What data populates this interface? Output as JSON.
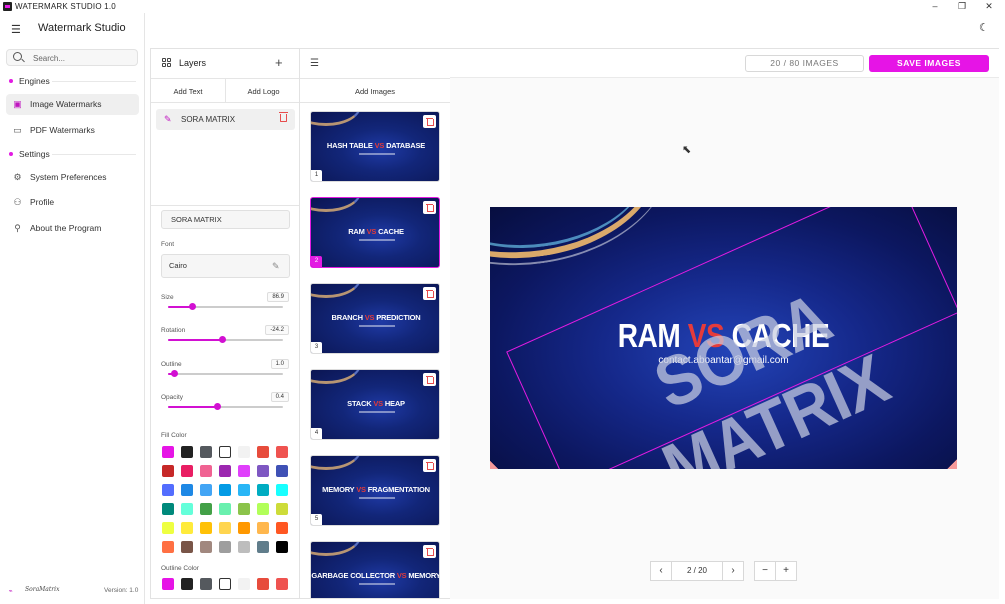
{
  "window": {
    "title": "WATERMARK STUDIO 1.0",
    "minimize": "–",
    "maximize": "❐",
    "close": "✕"
  },
  "sidebar": {
    "app_name": "Watermark Studio",
    "search_placeholder": "Search...",
    "engines_heading": "Engines",
    "settings_heading": "Settings",
    "engines": [
      {
        "label": "Image Watermarks",
        "icon": "image-icon",
        "active": true
      },
      {
        "label": "PDF Watermarks",
        "icon": "pdf-icon",
        "active": false
      }
    ],
    "settings": [
      {
        "label": "System Preferences",
        "icon": "gear-icon"
      },
      {
        "label": "Profile",
        "icon": "user-icon"
      },
      {
        "label": "About the Program",
        "icon": "info-icon"
      }
    ],
    "brand": "SoraMatrix",
    "version": "Version: 1.0"
  },
  "layers": {
    "title": "Layers",
    "add_text": "Add Text",
    "add_logo": "Add Logo",
    "items": [
      {
        "name": "SORA MATRIX"
      }
    ],
    "text_value": "SORA MATRIX",
    "font_label": "Font",
    "font_value": "Cairo",
    "sliders": [
      {
        "label": "Size",
        "value": "86.9",
        "fraction": 0.21
      },
      {
        "label": "Rotation",
        "value": "-24.2",
        "fraction": 0.47
      },
      {
        "label": "Outline",
        "value": "1.0",
        "fraction": 0.05
      },
      {
        "label": "Opacity",
        "value": "0.4",
        "fraction": 0.43
      }
    ],
    "fill_color_label": "Fill Color",
    "outline_color_label": "Outline Color",
    "fill_colors": [
      [
        "#e614e6",
        "#222222",
        "#55595e",
        "#ffffff",
        "#f2f2f2",
        "#e74c3c",
        "#ef5350"
      ],
      [
        "#c62828",
        "#e91e63",
        "#f06292",
        "#9c27b0",
        "#e040fb",
        "#7e57c2",
        "#3f51b5"
      ],
      [
        "#536dfe",
        "#1e88e5",
        "#42a5f5",
        "#039be5",
        "#29b6f6",
        "#00acc1",
        "#18ffff"
      ],
      [
        "#00897b",
        "#64ffda",
        "#43a047",
        "#69f0ae",
        "#8bc34a",
        "#b2ff59",
        "#cddc39"
      ],
      [
        "#eeff41",
        "#ffeb3b",
        "#ffc107",
        "#ffd54f",
        "#ff9800",
        "#ffb74d",
        "#ff5722"
      ],
      [
        "#ff7043",
        "#795548",
        "#a1887f",
        "#9e9e9e",
        "#bdbdbd",
        "#607d8b",
        "#000000"
      ]
    ],
    "outline_colors": [
      "#e614e6",
      "#222222",
      "#55595e",
      "#ffffff",
      "#f2f2f2",
      "#e74c3c",
      "#ef5350"
    ]
  },
  "images_panel": {
    "add_images": "Add Images",
    "thumbnails": [
      {
        "left": "HASH TABLE",
        "vs": "VS",
        "right": "DATABASE",
        "num": "1",
        "selected": false
      },
      {
        "left": "RAM",
        "vs": "VS",
        "right": "CACHE",
        "num": "2",
        "selected": true
      },
      {
        "left": "BRANCH",
        "vs": "VS",
        "right": "PREDICTION",
        "num": "3",
        "selected": false
      },
      {
        "left": "STACK",
        "vs": "VS",
        "right": "HEAP",
        "num": "4",
        "selected": false
      },
      {
        "left": "MEMORY",
        "vs": "VS",
        "right": "FRAGMENTATION",
        "num": "5",
        "selected": false
      },
      {
        "left": "GARBAGE COLLECTOR",
        "vs": "VS",
        "right": "MEMORY",
        "num": "6",
        "selected": false
      }
    ]
  },
  "main": {
    "image_count": "20 / 80 IMAGES",
    "save_button": "SAVE IMAGES",
    "preview": {
      "title_left": "RAM",
      "title_vs": "VS",
      "title_right": "CACHE",
      "email": "contact.aboantar@gmail.com",
      "watermark_text": "SORA MATRIX",
      "watermark_rotation_deg": -24.2
    },
    "pager": {
      "prev": "‹",
      "page": "2 / 20",
      "next": "›",
      "zoom_out": "−",
      "zoom_in": "+"
    }
  },
  "colors": {
    "accent": "#e614e6",
    "danger": "#e74c4c"
  }
}
